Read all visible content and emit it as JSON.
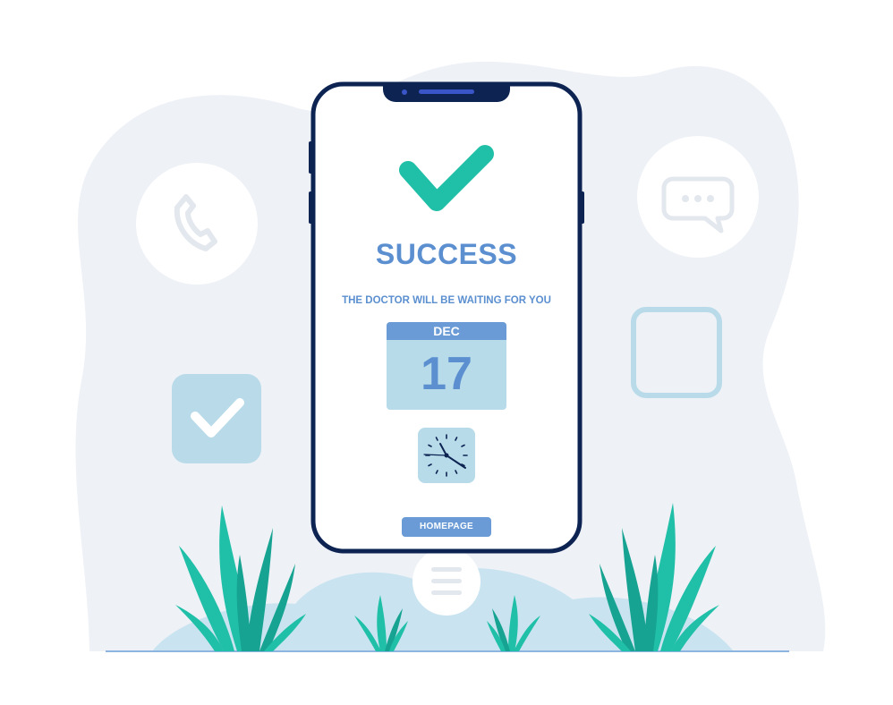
{
  "screen": {
    "title": "SUCCESS",
    "subtitle": "THE DOCTOR WILL BE WAITING FOR YOU",
    "calendar": {
      "month": "DEC",
      "day": "17"
    },
    "button_label": "HOMEPAGE"
  },
  "icons": [
    "phone-icon",
    "chat-bubble-icon",
    "checkbox-checked-icon",
    "checkbox-empty-icon",
    "checkmark-icon",
    "calendar-icon",
    "clock-icon",
    "menu-icon",
    "plant-icon"
  ],
  "colors": {
    "accent": "#1fbfa8",
    "text_blue": "#5b8fd0",
    "phone_frame": "#0d2453",
    "light_blue": "#b7dbe9",
    "background_blob": "#eef1f6"
  }
}
